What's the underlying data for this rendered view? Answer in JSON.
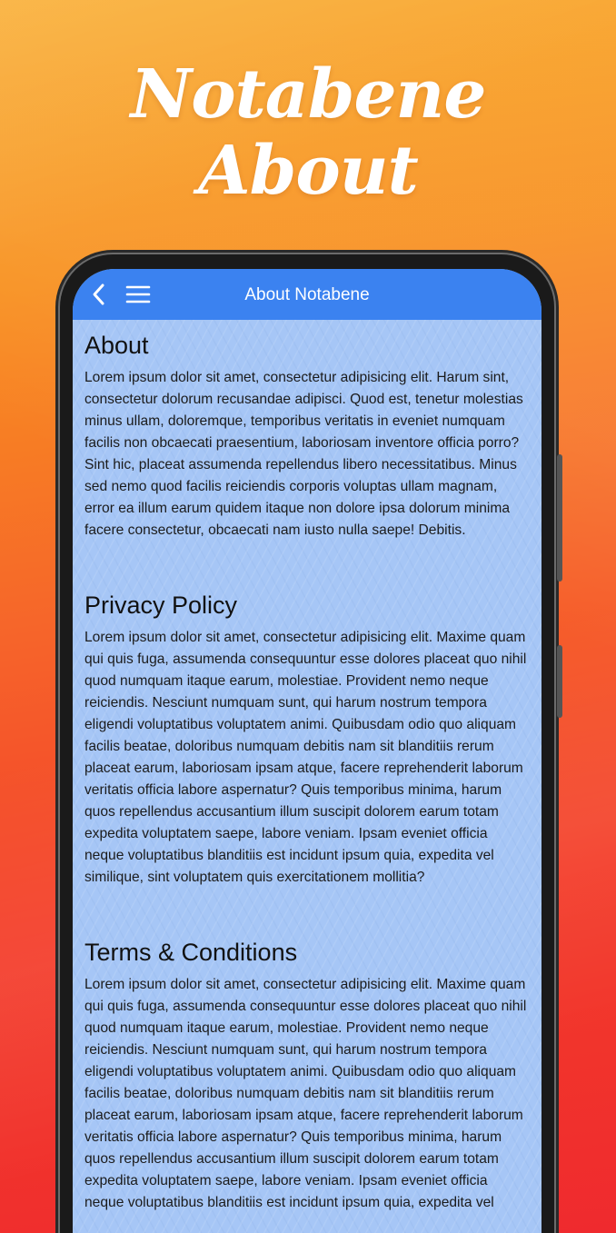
{
  "promo": {
    "title_line1": "Notabene",
    "title_line2": "About"
  },
  "app_bar": {
    "title": "About Notabene",
    "back_icon": "chevron-left-icon",
    "menu_icon": "hamburger-menu-icon",
    "color": "#3b82f0"
  },
  "sections": [
    {
      "heading": "About",
      "body": "Lorem ipsum dolor sit amet, consectetur adipisicing elit. Harum sint, consectetur dolorum recusandae adipisci. Quod est, tenetur molestias minus ullam, doloremque, temporibus veritatis in eveniet numquam facilis non obcaecati praesentium, laboriosam inventore officia porro? Sint hic, placeat assumenda repellendus libero necessitatibus. Minus sed nemo quod facilis reiciendis corporis voluptas ullam magnam, error ea illum earum quidem itaque non dolore ipsa dolorum minima facere consectetur, obcaecati nam iusto nulla saepe! Debitis."
    },
    {
      "heading": "Privacy Policy",
      "body": "Lorem ipsum dolor sit amet, consectetur adipisicing elit. Maxime quam qui quis fuga, assumenda consequuntur esse dolores placeat quo nihil quod numquam itaque earum, molestiae. Provident nemo neque reiciendis. Nesciunt numquam sunt, qui harum nostrum tempora eligendi voluptatibus voluptatem animi. Quibusdam odio quo aliquam facilis beatae, doloribus numquam debitis nam sit blanditiis rerum placeat earum, laboriosam ipsam atque, facere reprehenderit laborum veritatis officia labore aspernatur? Quis temporibus minima, harum quos repellendus accusantium illum suscipit dolorem earum totam expedita voluptatem saepe, labore veniam. Ipsam eveniet officia neque voluptatibus blanditiis est incidunt ipsum quia, expedita vel similique, sint voluptatem quis exercitationem mollitia?"
    },
    {
      "heading": "Terms & Conditions",
      "body": "Lorem ipsum dolor sit amet, consectetur adipisicing elit. Maxime quam qui quis fuga, assumenda consequuntur esse dolores placeat quo nihil quod numquam itaque earum, molestiae. Provident nemo neque reiciendis. Nesciunt numquam sunt, qui harum nostrum tempora eligendi voluptatibus voluptatem animi. Quibusdam odio quo aliquam facilis beatae, doloribus numquam debitis nam sit blanditiis rerum placeat earum, laboriosam ipsam atque, facere reprehenderit laborum veritatis officia labore aspernatur? Quis temporibus minima, harum quos repellendus accusantium illum suscipit dolorem earum totam expedita voluptatem saepe, labore veniam. Ipsam eveniet officia neque voluptatibus blanditiis est incidunt ipsum quia, expedita vel"
    }
  ]
}
